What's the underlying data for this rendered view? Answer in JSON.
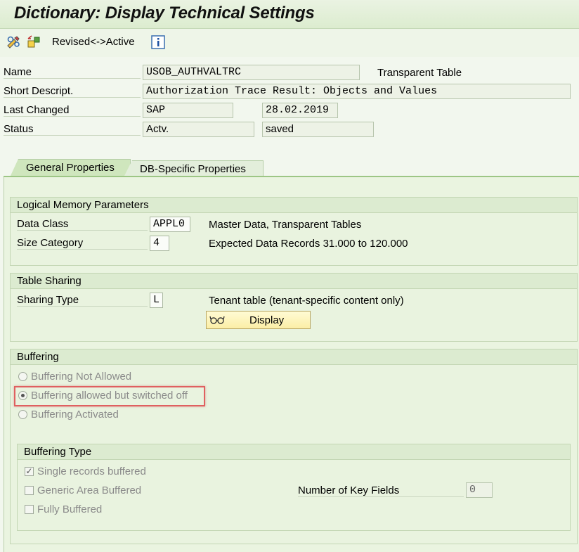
{
  "window": {
    "title": "Dictionary: Display Technical Settings"
  },
  "toolbar": {
    "icons": [
      "display-change-icon",
      "activate-icon",
      "info-icon"
    ],
    "revised_active_label": "Revised<->Active"
  },
  "header": {
    "name_label": "Name",
    "name_value": "USOB_AUTHVALTRC",
    "table_type": "Transparent Table",
    "short_descr_label": "Short Descript.",
    "short_descr_value": "Authorization Trace Result: Objects and Values",
    "last_changed_label": "Last Changed",
    "last_changed_user": "SAP",
    "last_changed_date": "28.02.2019",
    "status_label": "Status",
    "status_value": "Actv.",
    "status_saved": "saved"
  },
  "tabs": [
    {
      "label": "General Properties",
      "active": true
    },
    {
      "label": "DB-Specific Properties",
      "active": false
    }
  ],
  "logical_memory": {
    "title": "Logical Memory Parameters",
    "data_class_label": "Data Class",
    "data_class_value": "APPL0",
    "data_class_text": "Master Data, Transparent Tables",
    "size_category_label": "Size Category",
    "size_category_value": "4",
    "size_category_text": "Expected Data Records 31.000 to 120.000"
  },
  "table_sharing": {
    "title": "Table Sharing",
    "sharing_type_label": "Sharing Type",
    "sharing_type_value": "L",
    "sharing_type_text": "Tenant table (tenant-specific content only)",
    "display_button": "Display"
  },
  "buffering": {
    "title": "Buffering",
    "options": [
      {
        "label": "Buffering Not Allowed",
        "selected": false
      },
      {
        "label": "Buffering allowed but switched off",
        "selected": true
      },
      {
        "label": "Buffering Activated",
        "selected": false
      }
    ],
    "highlight_color": "#e06060"
  },
  "buffering_type": {
    "title": "Buffering Type",
    "options": [
      {
        "label": "Single records buffered",
        "checked": true
      },
      {
        "label": "Generic Area Buffered",
        "checked": false
      },
      {
        "label": "Fully Buffered",
        "checked": false
      }
    ],
    "key_fields_label": "Number of Key Fields",
    "key_fields_value": "0"
  },
  "colors": {
    "background": "#f2f7ee",
    "tab_active": "#cfe6bd",
    "button": "#fbeea6"
  }
}
